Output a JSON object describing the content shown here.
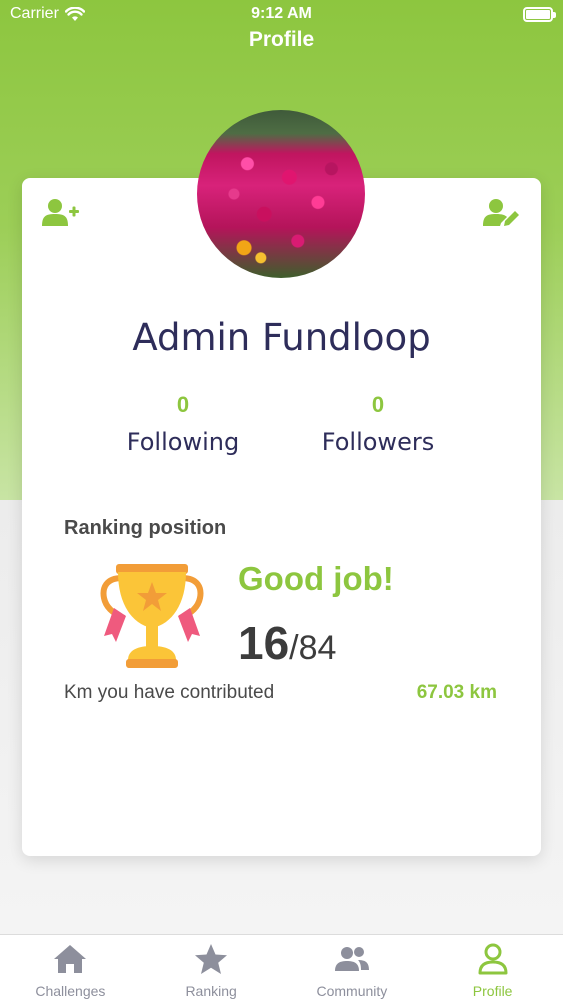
{
  "status_bar": {
    "carrier": "Carrier",
    "time": "9:12 AM"
  },
  "nav": {
    "title": "Profile"
  },
  "profile": {
    "name": "Admin Fundloop",
    "following_count": "0",
    "following_label": "Following",
    "followers_count": "0",
    "followers_label": "Followers"
  },
  "ranking": {
    "title": "Ranking position",
    "message": "Good job!",
    "position": "16",
    "separator": "/",
    "total": "84",
    "km_label": "Km you have contributed",
    "km_value": "67.03 km"
  },
  "tabs": [
    {
      "label": "Challenges",
      "icon": "home-icon"
    },
    {
      "label": "Ranking",
      "icon": "star-icon"
    },
    {
      "label": "Community",
      "icon": "users-icon"
    },
    {
      "label": "Profile",
      "icon": "user-icon"
    }
  ],
  "colors": {
    "accent": "#8dc63f",
    "name": "#2e2d5a",
    "tab_inactive": "#8d8f9c"
  }
}
